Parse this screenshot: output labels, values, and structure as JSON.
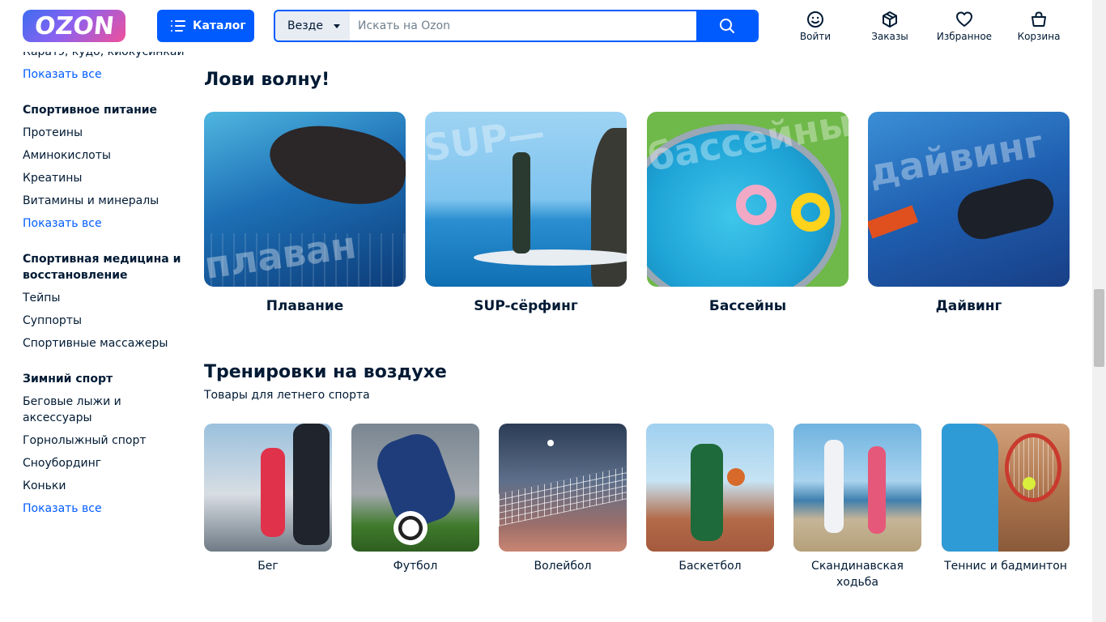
{
  "header": {
    "logo_text": "OZON",
    "catalog_label": "Каталог",
    "search_scope": "Везде",
    "search_placeholder": "Искать на Ozon",
    "actions": [
      {
        "label": "Войти",
        "icon": "user-icon"
      },
      {
        "label": "Заказы",
        "icon": "box-icon"
      },
      {
        "label": "Избранное",
        "icon": "heart-icon"
      },
      {
        "label": "Корзина",
        "icon": "cart-icon"
      }
    ]
  },
  "sidebar": {
    "cut_item": "Каратэ, кудо, киокусинкай",
    "show_all": "Показать все",
    "groups": [
      {
        "title": "Спортивное питание",
        "items": [
          "Протеины",
          "Аминокислоты",
          "Креатины",
          "Витамины и минералы"
        ],
        "show_all": "Показать все"
      },
      {
        "title_lines": [
          "Спортивная медицина и",
          "восстановление"
        ],
        "items": [
          "Тейпы",
          "Суппорты",
          "Спортивные массажеры"
        ]
      },
      {
        "title": "Зимний спорт",
        "items": [
          "Беговые лыжи и",
          "аксессуары",
          "Горнолыжный спорт",
          "Сноубординг",
          "Коньки"
        ],
        "show_all": "Показать все"
      }
    ]
  },
  "wave": {
    "title": "Лови волну!",
    "cards": [
      {
        "label": "Плавание",
        "overlay": "плаван"
      },
      {
        "label": "SUP-сёрфинг",
        "overlay": "SUP—"
      },
      {
        "label": "Бассейны",
        "overlay": "бассейны"
      },
      {
        "label": "Дайвинг",
        "overlay": "дайвинг"
      }
    ]
  },
  "outdoor": {
    "title": "Тренировки на воздухе",
    "subtitle": "Товары для летнего спорта",
    "cards": [
      {
        "label": "Бег"
      },
      {
        "label": "Футбол"
      },
      {
        "label": "Волейбол"
      },
      {
        "label": "Баскетбол"
      },
      {
        "label_lines": [
          "Скандинавская",
          "ходьба"
        ]
      },
      {
        "label": "Теннис и бадминтон"
      }
    ]
  },
  "colors": {
    "brand_blue": "#005bff",
    "text": "#001a34",
    "link": "#005bff"
  }
}
